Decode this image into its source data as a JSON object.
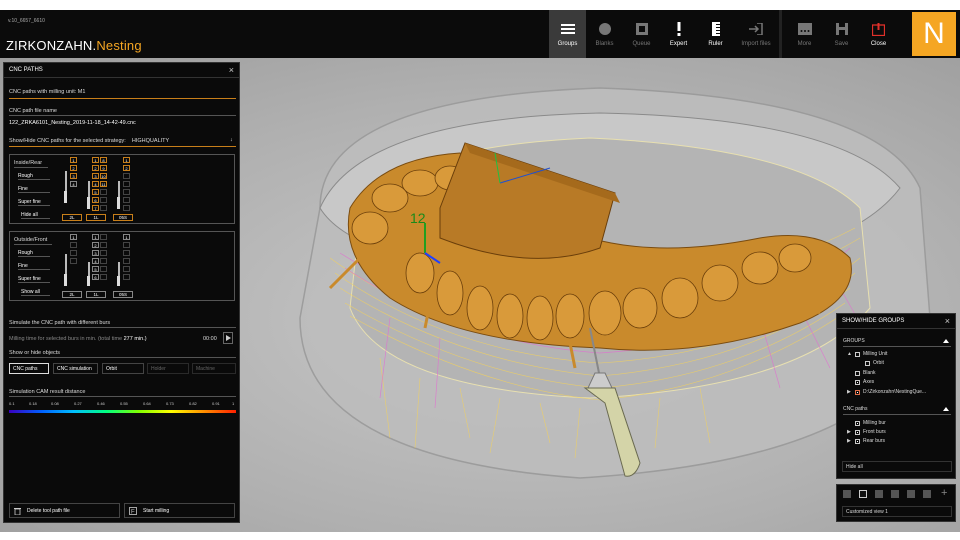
{
  "header": {
    "version": "v.10_6657_6610",
    "logo_brand": "ZIRKONZAHN.",
    "logo_product": "Nesting",
    "toolbar": [
      {
        "label": "Groups",
        "icon": "menu-icon",
        "state": "active"
      },
      {
        "label": "Blanks",
        "icon": "blob-icon",
        "state": "dim"
      },
      {
        "label": "Queue",
        "icon": "queue-icon",
        "state": "dim"
      },
      {
        "label": "Expert",
        "icon": "exclamation-icon",
        "state": "normal"
      },
      {
        "label": "Ruler",
        "icon": "ruler-icon",
        "state": "normal"
      },
      {
        "label": "Import files",
        "icon": "import-icon",
        "state": "dim"
      },
      {
        "label": "More",
        "icon": "more-icon",
        "state": "dim"
      },
      {
        "label": "Save",
        "icon": "save-icon",
        "state": "dim"
      },
      {
        "label": "Close",
        "icon": "close-icon",
        "state": "normal"
      }
    ],
    "n_logo": "N",
    "accent_color": "#f5a623"
  },
  "left_panel": {
    "title": "CNC PATHS",
    "milling_unit": "CNC paths with milling unit: M1",
    "file_name_label": "CNC path file name",
    "file_name": "122_ZRKA6101_Nesting_2019-11-18_14-42-49.cnc",
    "strategy_label": "Show/Hide CNC paths for the selected strategy:",
    "strategy_value": "HIGHQUALITY",
    "inside_group": {
      "title": "Inside/Rear",
      "buttons": [
        "Rough",
        "Fine",
        "Super fine",
        "Hide all"
      ],
      "col1": [
        "1",
        "2",
        "3",
        "4"
      ],
      "col2a": [
        "1",
        "2",
        "3",
        "4",
        "5",
        "6",
        "7"
      ],
      "col2b": [
        "8",
        "9",
        "10",
        "11",
        "",
        "",
        ""
      ],
      "col3": [
        "1",
        "2"
      ],
      "tags": [
        "2L",
        "1L",
        "05S"
      ]
    },
    "outside_group": {
      "title": "Outside/Front",
      "buttons": [
        "Rough",
        "Fine",
        "Super fine",
        "Show all"
      ],
      "col1": [
        "1"
      ],
      "col2": [
        "1",
        "2",
        "3",
        "4",
        "5",
        "6"
      ],
      "col3": [
        "1"
      ],
      "tags": [
        "2L",
        "1L",
        "05S"
      ]
    },
    "simulate_label": "Simulate the CNC path with different burs",
    "milling_time_label": "Milling time for selected burs in min. (total time",
    "milling_time_value": "277",
    "milling_time_unit": "min.)",
    "timer": "00:00",
    "show_hide_label": "Show or hide objects",
    "objects": [
      {
        "label": "CNC paths",
        "state": "sel"
      },
      {
        "label": "CNC simulation",
        "state": "normal"
      },
      {
        "label": "Orbit",
        "state": "normal"
      },
      {
        "label": "Holder",
        "state": "dim"
      },
      {
        "label": "Machine",
        "state": "dim"
      }
    ],
    "cam_label": "Simulation CAM result distance",
    "scale": [
      "0.1",
      "0.18",
      "0.08",
      "0.27",
      "0.46",
      "0.55",
      "0.64",
      "0.73",
      "0.82",
      "0.91",
      "1"
    ],
    "delete_btn": "Delete tool path file",
    "start_btn": "Start milling"
  },
  "right_panel": {
    "title": "SHOW/HIDE GROUPS",
    "groups_label": "GROUPS",
    "items": [
      {
        "label": "Milling Unit",
        "checked": false,
        "caret": true
      },
      {
        "label": "Orbit",
        "checked": false,
        "caret": false
      },
      {
        "label": "Blank",
        "checked": false,
        "caret": false
      },
      {
        "label": "Axes",
        "checked": true,
        "caret": false
      },
      {
        "label": "D:\\Zirkonzahn\\NestingQue...",
        "checked": true,
        "caret": true
      }
    ],
    "cnc_label": "CNC paths",
    "cnc_items": [
      {
        "label": "Milling bur",
        "checked": true,
        "caret": false
      },
      {
        "label": "Front burs",
        "checked": true,
        "caret": true
      },
      {
        "label": "Rear burs",
        "checked": true,
        "caret": true
      }
    ],
    "hide_all": "Hide all"
  },
  "view_panel": {
    "view_name": "Customized view 1"
  },
  "scene": {
    "annotation": "12"
  }
}
